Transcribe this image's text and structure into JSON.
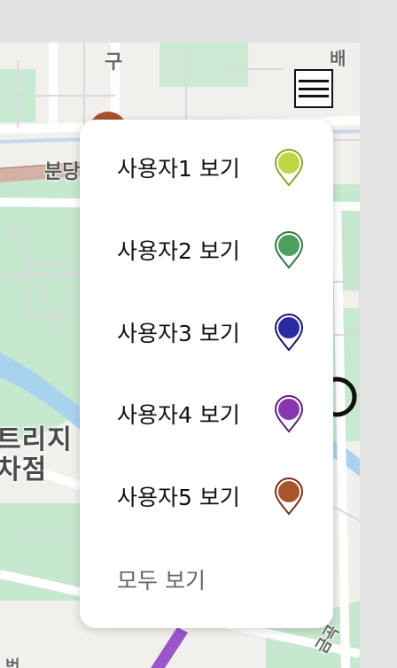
{
  "map": {
    "labels": {
      "road_top": "구",
      "road_top_right": "배",
      "road_left": "분당",
      "place_line1": "트리지",
      "place_line2": "차점",
      "road_bottom_left": "번",
      "road_bottom_right": "금곡"
    }
  },
  "menu_button": {
    "icon": "hamburger-menu-icon"
  },
  "popup": {
    "items": [
      {
        "label": "사용자1 보기",
        "pin_color": "#c0d644",
        "pin_border": "#8fa528"
      },
      {
        "label": "사용자2 보기",
        "pin_color": "#4fa060",
        "pin_border": "#2f7a42"
      },
      {
        "label": "사용자3 보기",
        "pin_color": "#2a2aa5",
        "pin_border": "#17176e"
      },
      {
        "label": "사용자4 보기",
        "pin_color": "#8a36b0",
        "pin_border": "#5e1f7e"
      },
      {
        "label": "사용자5 보기",
        "pin_color": "#a9542d",
        "pin_border": "#74331a"
      }
    ],
    "all_label": "모두 보기"
  }
}
